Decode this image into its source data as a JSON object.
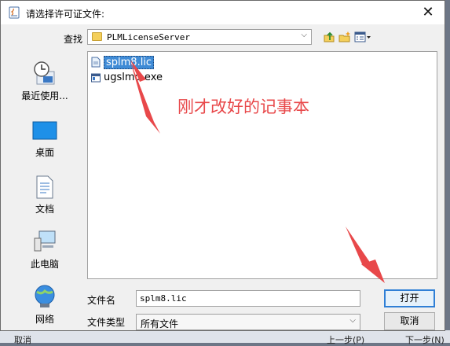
{
  "dialog": {
    "title": "请选择许可证文件:",
    "close_glyph": "✕"
  },
  "toolbar": {
    "look_in_label": "查找",
    "look_in_value": "PLMLicenseServer",
    "combo_arrow": "⌵",
    "icons": [
      "up-folder-icon",
      "new-folder-icon",
      "view-menu-icon"
    ]
  },
  "places": [
    {
      "label": "最近使用...",
      "icon": "recent-items-icon"
    },
    {
      "label": "桌面",
      "icon": "desktop-icon"
    },
    {
      "label": "文档",
      "icon": "documents-icon"
    },
    {
      "label": "此电脑",
      "icon": "computer-icon"
    },
    {
      "label": "网络",
      "icon": "network-icon"
    }
  ],
  "files": [
    {
      "name": "splm8.lic",
      "selected": true,
      "icon": "file-icon"
    },
    {
      "name": "ugslmd.exe",
      "selected": false,
      "icon": "executable-icon"
    }
  ],
  "annotation": {
    "text": "刚才改好的记事本",
    "color": "#e8484a"
  },
  "form": {
    "file_name_label": "文件名",
    "file_name_value": "splm8.lic",
    "file_type_label": "文件类型",
    "file_type_value": "所有文件",
    "open_button": "打开",
    "cancel_button": "取消"
  },
  "background": {
    "left_button": "取消",
    "prev_button": "上一步(P)",
    "next_button": "下一步(N)"
  },
  "colors": {
    "selection": "#3f8bd6",
    "default_button_border": "#2f7fd6",
    "folder": "#f4cf5b"
  }
}
